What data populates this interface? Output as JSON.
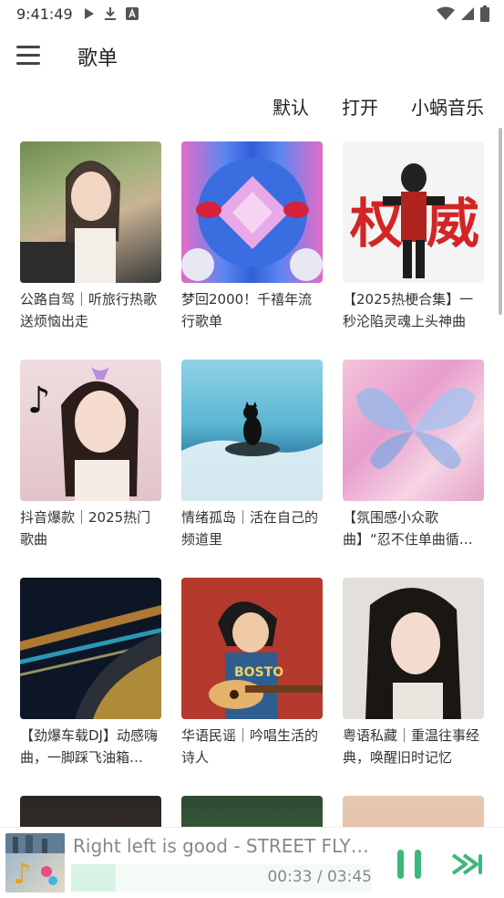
{
  "status_bar": {
    "time": "9:41:49",
    "left_icons": [
      "play-icon",
      "download-icon",
      "a-icon"
    ],
    "right_icons": [
      "wifi-icon",
      "signal-icon",
      "battery-icon"
    ]
  },
  "app_bar": {
    "title": "歌单"
  },
  "filters": {
    "default": "默认",
    "open": "打开",
    "source": "小蜗音乐"
  },
  "playlists": [
    {
      "title": "公路自驾｜听旅行热歌送烦恼出走",
      "cover_color": "#8aa36b"
    },
    {
      "title": "梦回2000！千禧年流行歌单",
      "cover_color": "#4a7be0"
    },
    {
      "title": "【2025热梗合集】一秒沦陷灵魂上头神曲",
      "cover_color": "#f2f2f2"
    },
    {
      "title": "抖音爆款｜2025热门歌曲",
      "cover_color": "#e9d3d7"
    },
    {
      "title": "情绪孤岛｜活在自己的频道里",
      "cover_color": "#3f8fb5"
    },
    {
      "title": "【氛围感小众歌曲】“忍不住单曲循…",
      "cover_color": "#e8b7d6"
    },
    {
      "title": "【劲爆车载DJ】动感嗨曲，一脚踩飞油箱…",
      "cover_color": "#0e1a2a"
    },
    {
      "title": "华语民谣｜吟唱生活的诗人",
      "cover_color": "#b33a2c"
    },
    {
      "title": "粤语私藏｜重温往事经典，唤醒旧时记忆",
      "cover_color": "#d9d4cf"
    },
    {
      "title": "",
      "cover_color": "#2b2622"
    },
    {
      "title": "",
      "cover_color": "#3d5b3f"
    },
    {
      "title": "",
      "cover_color": "#e9a88f"
    }
  ],
  "player": {
    "title": "Right left is good - STREET FLY RA...",
    "time": "00:33 / 03:45",
    "progress": 0.147,
    "accent": "#3cb878"
  }
}
